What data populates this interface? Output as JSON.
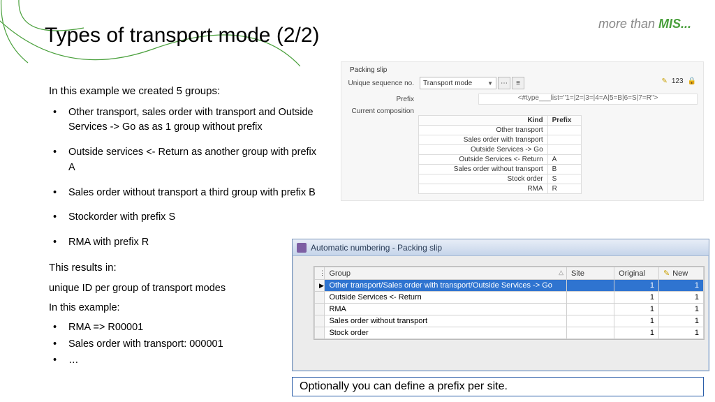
{
  "brand": {
    "pre": "more than ",
    "em": "MIS..."
  },
  "title": "Types of transport mode (2/2)",
  "intro": "In this example we created 5 groups:",
  "bullets": [
    "Other transport, sales order with transport and Outside Services -> Go as as 1 group without prefix",
    "Outside services <- Return as another group with prefix A",
    "Sales order without transport a third group with prefix B",
    "Stockorder with prefix S",
    "RMA with prefix R"
  ],
  "results_heading": "This results in:",
  "results_line": "unique ID per group of transport modes",
  "example_heading": "In this example:",
  "example_bullets": [
    "RMA => R00001",
    "Sales order with transport: 000001",
    "…"
  ],
  "panel": {
    "heading": "Packing slip",
    "seq_label": "Unique sequence no.",
    "seq_value": "Transport mode",
    "seq_count": "123",
    "prefix_label": "Prefix",
    "prefix_value": "<#type___list=\"1=|2=|3=|4=A|5=B|6=S|7=R\">",
    "comp_label": "Current composition",
    "kind_header": "Kind",
    "prefix_header": "Prefix",
    "rows": [
      {
        "kind": "Other transport",
        "prefix": ""
      },
      {
        "kind": "Sales order with transport",
        "prefix": ""
      },
      {
        "kind": "Outside Services -> Go",
        "prefix": ""
      },
      {
        "kind": "Outside Services <- Return",
        "prefix": "A"
      },
      {
        "kind": "Sales order without transport",
        "prefix": "B"
      },
      {
        "kind": "Stock order",
        "prefix": "S"
      },
      {
        "kind": "RMA",
        "prefix": "R"
      }
    ]
  },
  "window": {
    "title": "Automatic numbering - Packing slip",
    "cols": {
      "group": "Group",
      "site": "Site",
      "original": "Original",
      "new": "New"
    },
    "rows": [
      {
        "group": "Other transport/Sales order with transport/Outside Services -> Go",
        "site": "",
        "original": "1",
        "new": "1",
        "selected": true
      },
      {
        "group": "Outside Services <- Return",
        "site": "",
        "original": "1",
        "new": "1"
      },
      {
        "group": "RMA",
        "site": "",
        "original": "1",
        "new": "1"
      },
      {
        "group": "Sales order without transport",
        "site": "",
        "original": "1",
        "new": "1"
      },
      {
        "group": "Stock order",
        "site": "",
        "original": "1",
        "new": "1"
      }
    ]
  },
  "callout": "Optionally you can define a prefix per site."
}
